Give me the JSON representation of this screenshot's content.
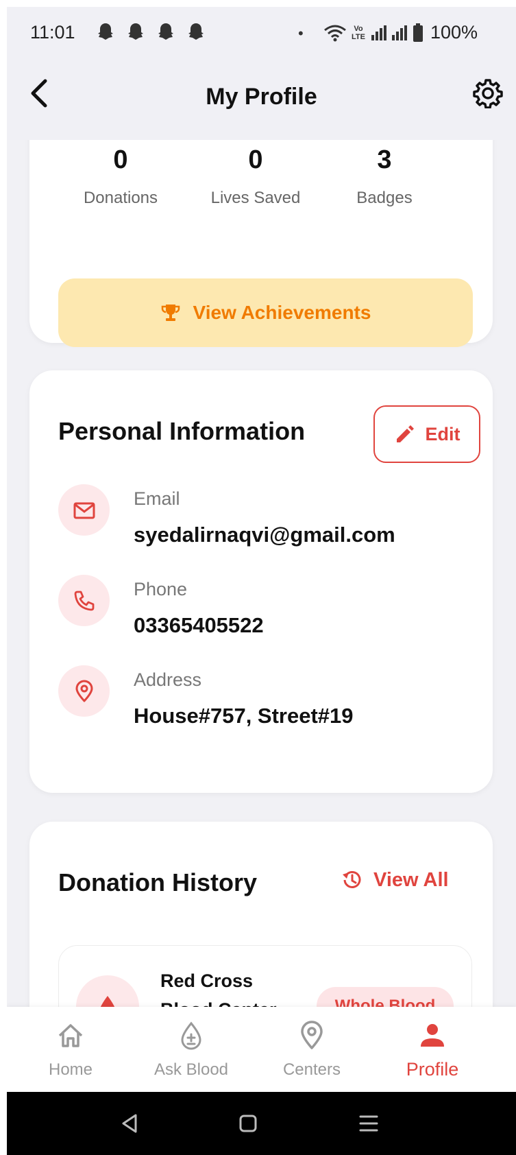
{
  "status_bar": {
    "time": "11:01",
    "battery": "100%",
    "network_label": "Vo LTE"
  },
  "header": {
    "title": "My Profile",
    "back_icon": "chevron-left-icon",
    "settings_icon": "gear-icon"
  },
  "stats": {
    "items": [
      {
        "value": "0",
        "label": "Donations"
      },
      {
        "value": "0",
        "label": "Lives Saved"
      },
      {
        "value": "3",
        "label": "Badges"
      }
    ],
    "achievements_button": "View Achievements",
    "achievements_icon": "trophy-icon"
  },
  "personal_info": {
    "title": "Personal Information",
    "edit_label": "Edit",
    "rows": [
      {
        "label": "Email",
        "value": "syedalirnaqvi@gmail.com",
        "icon": "mail-icon"
      },
      {
        "label": "Phone",
        "value": "03365405522",
        "icon": "phone-icon"
      },
      {
        "label": "Address",
        "value": "House#757, Street#19",
        "icon": "location-pin-icon"
      }
    ]
  },
  "donation_history": {
    "title": "Donation History",
    "view_all_label": "View All",
    "items": [
      {
        "center": "Red Cross Blood Center",
        "type": "Whole Blood",
        "icon": "blood-drop-icon"
      }
    ]
  },
  "bottom_nav": {
    "items": [
      {
        "label": "Home",
        "icon": "home-icon",
        "active": false
      },
      {
        "label": "Ask Blood",
        "icon": "blood-drop-plus-icon",
        "active": false
      },
      {
        "label": "Centers",
        "icon": "location-pin-icon",
        "active": false
      },
      {
        "label": "Profile",
        "icon": "person-icon",
        "active": true
      }
    ]
  },
  "colors": {
    "accent": "#e0443e",
    "achievement_bg": "#fde8b0",
    "achievement_text": "#f07b00",
    "icon_circle_bg": "#fde8ea"
  }
}
